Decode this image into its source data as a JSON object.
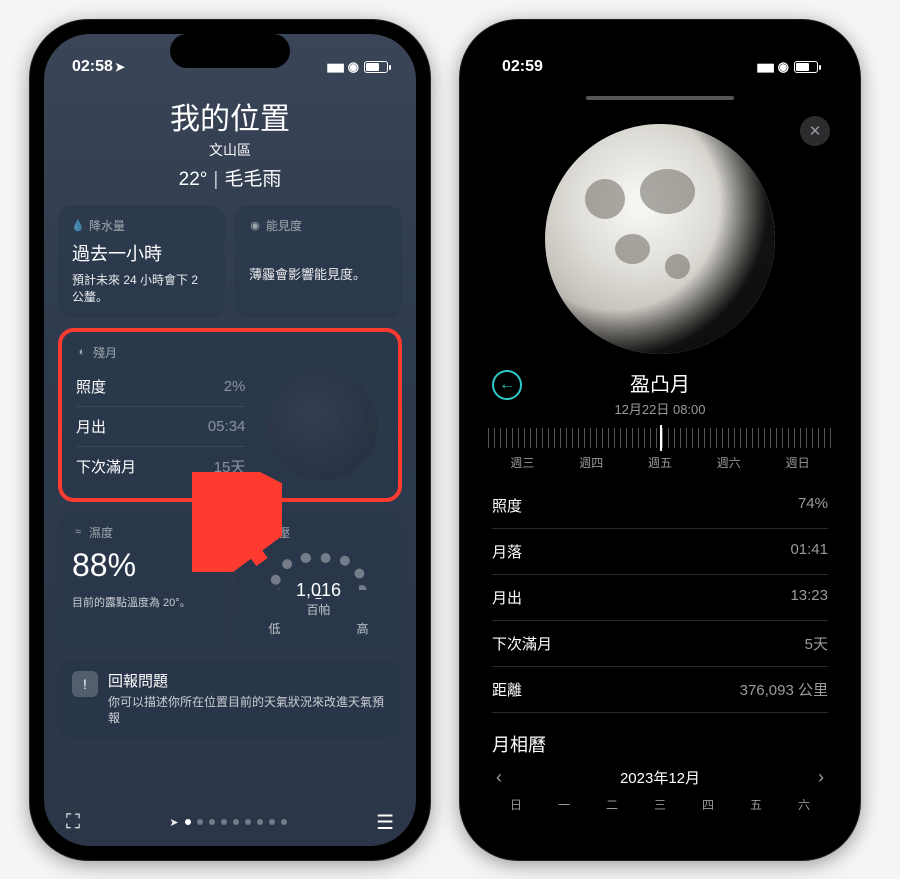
{
  "left": {
    "status_time": "02:58",
    "header": {
      "title": "我的位置",
      "sub": "文山區",
      "temp": "22°",
      "cond": "毛毛雨"
    },
    "precip": {
      "label": "降水量",
      "title": "過去一小時",
      "desc": "預計未來 24 小時會下 2 公釐。"
    },
    "visibility": {
      "label": "能見度",
      "desc": "薄霾會影響能見度。"
    },
    "moon": {
      "label": "殘月",
      "rows": [
        {
          "k": "照度",
          "v": "2%"
        },
        {
          "k": "月出",
          "v": "05:34"
        },
        {
          "k": "下次滿月",
          "v": "15天"
        }
      ]
    },
    "humidity": {
      "label": "濕度",
      "value": "88%",
      "note": "目前的露點溫度為 20°。"
    },
    "pressure": {
      "label": "氣壓",
      "value": "1,016",
      "unit": "百帕",
      "low": "低",
      "high": "高"
    },
    "report": {
      "title": "回報問題",
      "desc": "你可以描述你所在位置目前的天氣狀況來改進天氣預報"
    }
  },
  "right": {
    "status_time": "02:59",
    "phase": "盈凸月",
    "datetime": "12月22日 08:00",
    "days": [
      "週三",
      "週四",
      "週五",
      "週六",
      "週日"
    ],
    "rows": [
      {
        "k": "照度",
        "v": "74%"
      },
      {
        "k": "月落",
        "v": "01:41"
      },
      {
        "k": "月出",
        "v": "13:23"
      },
      {
        "k": "下次滿月",
        "v": "5天"
      },
      {
        "k": "距離",
        "v": "376,093 公里"
      }
    ],
    "cal_title": "月相曆",
    "cal_month": "2023年12月",
    "weekdays": [
      "日",
      "一",
      "二",
      "三",
      "四",
      "五",
      "六"
    ]
  }
}
